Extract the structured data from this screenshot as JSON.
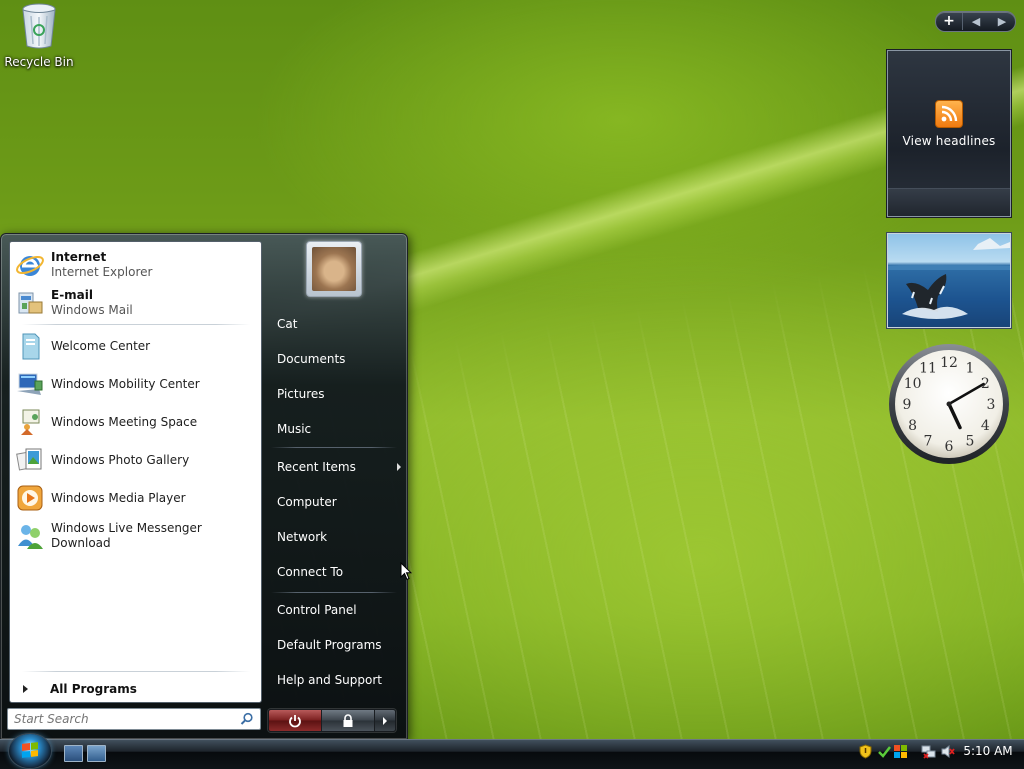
{
  "desktop": {
    "icons": [
      {
        "label": "Recycle Bin",
        "icon": "recycle-bin-icon"
      }
    ]
  },
  "sidebar": {
    "controls": {
      "add": "+",
      "prev": "◀",
      "next": "▶"
    },
    "feed_gadget": {
      "label": "View headlines",
      "icon": "rss-icon"
    },
    "clock_gadget": {
      "numbers": [
        "12",
        "1",
        "2",
        "3",
        "4",
        "5",
        "6",
        "7",
        "8",
        "9",
        "10",
        "11"
      ],
      "time": "5:10"
    }
  },
  "start_menu": {
    "pinned": [
      {
        "title": "Internet",
        "subtitle": "Internet Explorer",
        "icon": "internet-explorer-icon"
      },
      {
        "title": "E-mail",
        "subtitle": "Windows Mail",
        "icon": "windows-mail-icon"
      }
    ],
    "recent": [
      {
        "label": "Welcome Center",
        "icon": "welcome-center-icon"
      },
      {
        "label": "Windows Mobility Center",
        "icon": "mobility-center-icon"
      },
      {
        "label": "Windows Meeting Space",
        "icon": "meeting-space-icon"
      },
      {
        "label": "Windows Photo Gallery",
        "icon": "photo-gallery-icon"
      },
      {
        "label": "Windows Media Player",
        "icon": "media-player-icon"
      },
      {
        "label": "Windows Live Messenger Download",
        "icon": "messenger-icon"
      }
    ],
    "all_programs": "All Programs",
    "search_placeholder": "Start Search",
    "right": {
      "user": "Cat",
      "documents": "Documents",
      "pictures": "Pictures",
      "music": "Music",
      "recent_items": "Recent Items",
      "computer": "Computer",
      "network": "Network",
      "connect_to": "Connect To",
      "control_panel": "Control Panel",
      "default_programs": "Default Programs",
      "help_support": "Help and Support"
    }
  },
  "taskbar": {
    "time": "5:10 AM",
    "colors": {
      "accent": "#2a8fd0",
      "power": "#8b2a2a"
    }
  }
}
